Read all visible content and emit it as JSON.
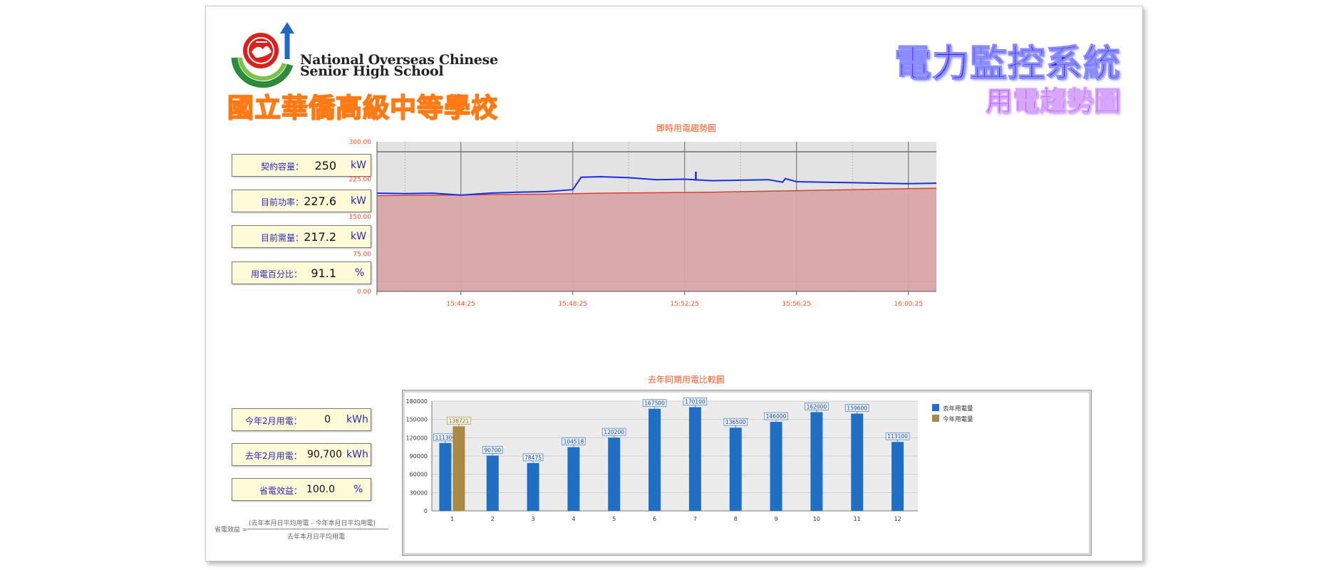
{
  "header": {
    "school_en_line1": "National Overseas Chinese",
    "school_en_line2": "Senior High School",
    "school_zh": "國立華僑高級中等學校",
    "system_title": "電力監控系統",
    "system_subtitle": "用電趨勢圖"
  },
  "top_panel": [
    {
      "label": "契約容量：",
      "value": "250",
      "unit": "kW"
    },
    {
      "label": "目前功率：",
      "value": "227.6",
      "unit": "kW"
    },
    {
      "label": "目前需量：",
      "value": "217.2",
      "unit": "kW"
    },
    {
      "label": "用電百分比：",
      "value": "91.1",
      "unit": "%"
    }
  ],
  "bottom_panel": [
    {
      "label": "今年2月用電：",
      "value": "0",
      "unit": "kWh"
    },
    {
      "label": "去年2月用電：",
      "value": "90,700",
      "unit": "kWh"
    },
    {
      "label": "省電效益：",
      "value": "100.0",
      "unit": "%"
    }
  ],
  "formula": {
    "prefix": "省電效益 =",
    "numerator": "(去年本月日平均用電 - 今年本月日平均用電)",
    "denominator": "去年本月日平均用電"
  },
  "colors": {
    "title_orange": "#ff5b27",
    "demand_line": "#1c2ce8",
    "area_fill": "#d9a5a5",
    "area_edge": "#d0453a",
    "bar_last_year": "#1f6fc5",
    "bar_this_year": "#a88a42"
  },
  "chart_data": [
    {
      "type": "area",
      "title": "即時用電趨勢圖",
      "x_tick_labels": [
        "15:44:25",
        "15:48:25",
        "15:52:25",
        "15:56:25",
        "16:00:25"
      ],
      "y_tick_labels": [
        "0.00",
        "75.00",
        "150.00",
        "225.00",
        "300.00"
      ],
      "ylim": [
        0,
        300
      ],
      "xlim_minutes": [
        -3,
        17
      ],
      "grid": true,
      "series": [
        {
          "style": "area",
          "x": [
            -3,
            3,
            5,
            9,
            12,
            17
          ],
          "values": [
            192,
            195,
            197,
            199,
            202,
            207
          ]
        },
        {
          "style": "line",
          "x": [
            -3,
            -2,
            -1,
            0,
            1,
            2,
            3,
            4,
            4.3,
            5,
            6,
            7,
            8,
            9,
            10,
            11,
            11.5,
            11.6,
            12,
            13,
            14,
            15,
            16,
            17
          ],
          "values": [
            197,
            196,
            197,
            193,
            197,
            199,
            200,
            204,
            229,
            230,
            228,
            224,
            225,
            222,
            223,
            224,
            219,
            226,
            220,
            219,
            218,
            217,
            216,
            217
          ]
        }
      ],
      "spike": {
        "x": 8.4,
        "value": 240
      }
    },
    {
      "type": "bar",
      "title": "去年同期用電比較圖",
      "categories": [
        "1",
        "2",
        "3",
        "4",
        "5",
        "6",
        "7",
        "8",
        "9",
        "10",
        "11",
        "12"
      ],
      "y_tick_labels": [
        "0",
        "30000",
        "60000",
        "90000",
        "120000",
        "150000",
        "180000"
      ],
      "ylim": [
        0,
        180000
      ],
      "legend_position": "right",
      "series": [
        {
          "name": "去年用電量",
          "values": [
            111300,
            90700,
            78475,
            104518,
            120200,
            167500,
            170100,
            136500,
            146000,
            162000,
            159600,
            113100
          ],
          "labels": [
            "111300",
            "90700",
            "78475",
            "104518",
            "120200",
            "167500",
            "170100",
            "136500",
            "146000",
            "162000",
            "159600",
            "113100"
          ]
        },
        {
          "name": "今年用電量",
          "values": [
            138721,
            null,
            null,
            null,
            null,
            null,
            null,
            null,
            null,
            null,
            null,
            null
          ],
          "labels": [
            "138721",
            "",
            "",
            "",
            "",
            "",
            "",
            "",
            "",
            "",
            "",
            ""
          ]
        }
      ]
    }
  ]
}
